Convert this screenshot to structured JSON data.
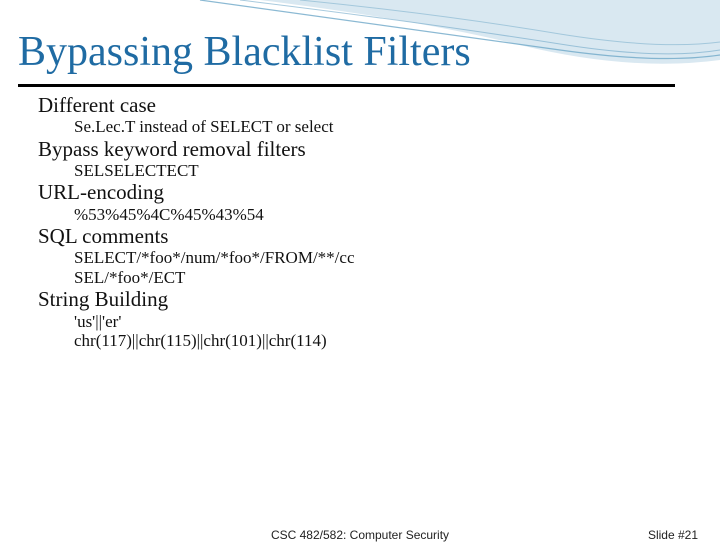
{
  "title": "Bypassing Blacklist Filters",
  "sections": [
    {
      "heading": "Different case",
      "items": [
        "Se.Lec.T instead of SELECT or select"
      ]
    },
    {
      "heading": "Bypass keyword removal filters",
      "items": [
        "SELSELECTECT"
      ]
    },
    {
      "heading": "URL-encoding",
      "items": [
        "%53%45%4C%45%43%54"
      ]
    },
    {
      "heading": "SQL comments",
      "items": [
        "SELECT/*foo*/num/*foo*/FROM/**/cc",
        "SEL/*foo*/ECT"
      ]
    },
    {
      "heading": "String Building",
      "items": [
        "'us'||'er'",
        "chr(117)||chr(115)||chr(101)||chr(114)"
      ]
    }
  ],
  "footer": {
    "center": "CSC 482/582: Computer Security",
    "right": "Slide #21"
  },
  "colors": {
    "title": "#1f6ba3",
    "curve_fill": "#b9d6e6",
    "curve_stroke": "#6ea7c8"
  }
}
